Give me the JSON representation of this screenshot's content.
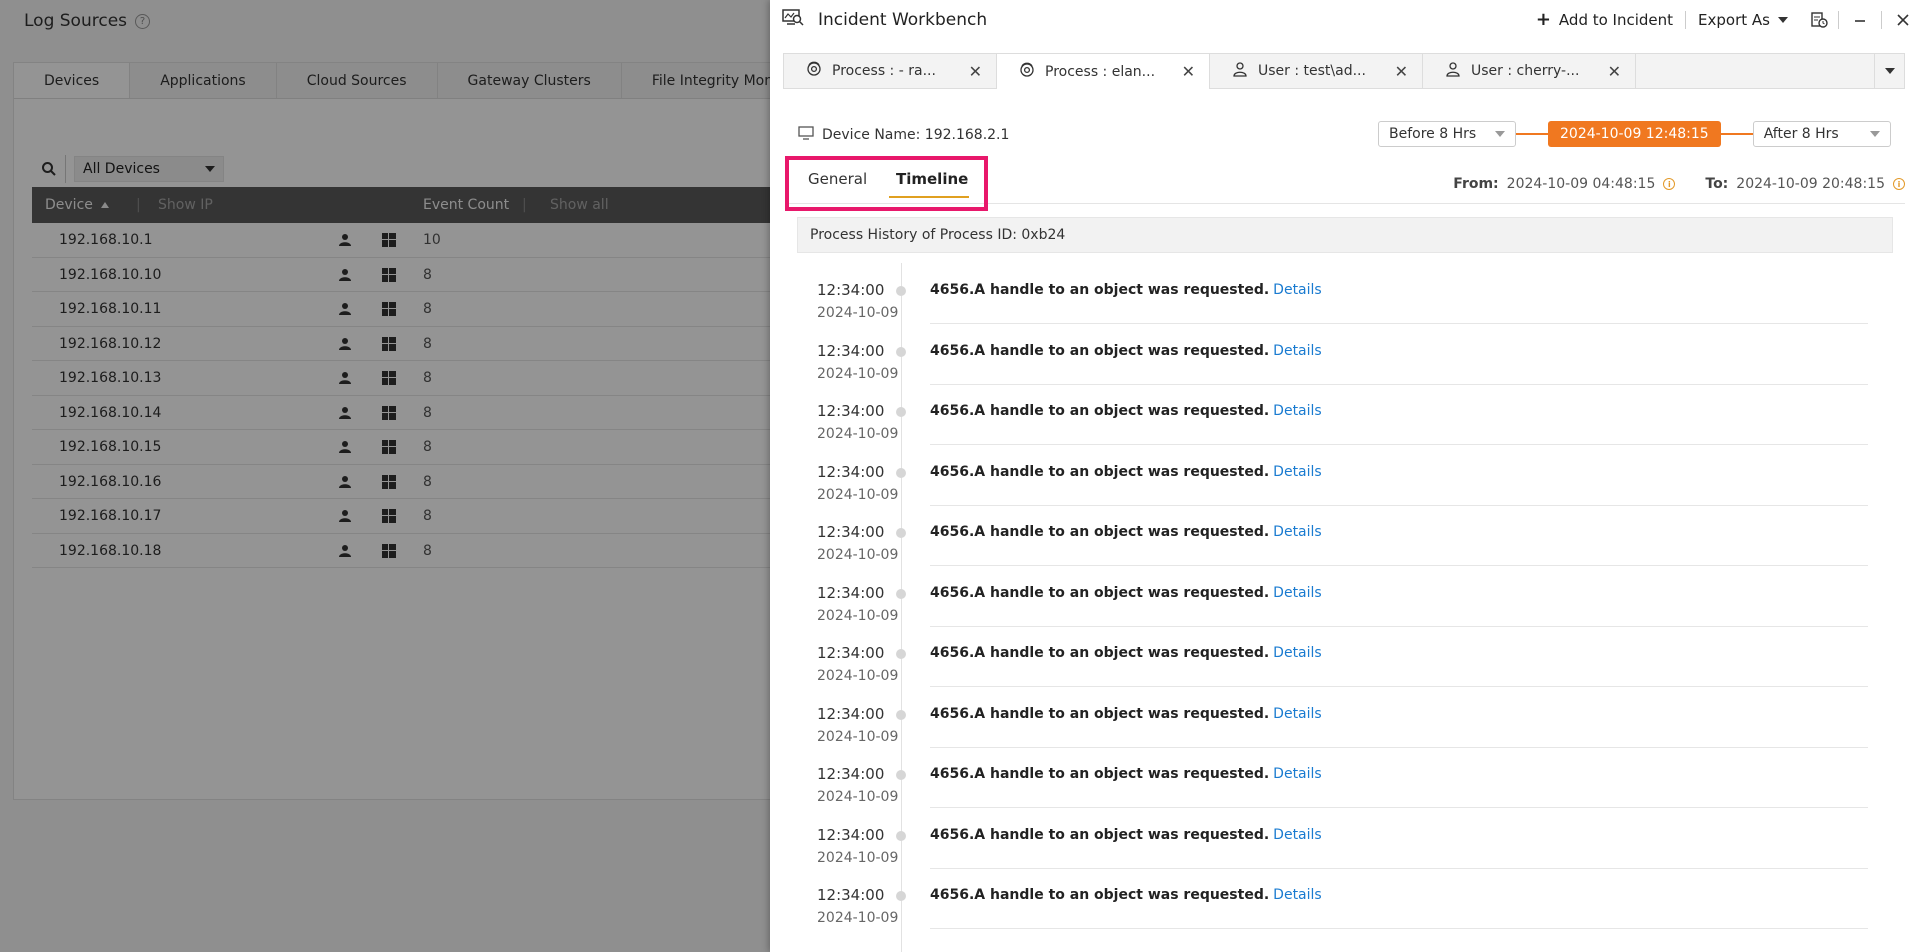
{
  "background": {
    "title": "Log Sources",
    "tabs": [
      "Devices",
      "Applications",
      "Cloud Sources",
      "Gateway Clusters",
      "File Integrity Monit"
    ],
    "filter_value": "All Devices",
    "columns": {
      "device": "Device",
      "show_ip": "Show IP",
      "event_count": "Event Count",
      "show_all": "Show all"
    },
    "rows": [
      {
        "ip": "192.168.10.1",
        "count": "10"
      },
      {
        "ip": "192.168.10.10",
        "count": "8"
      },
      {
        "ip": "192.168.10.11",
        "count": "8"
      },
      {
        "ip": "192.168.10.12",
        "count": "8"
      },
      {
        "ip": "192.168.10.13",
        "count": "8"
      },
      {
        "ip": "192.168.10.14",
        "count": "8"
      },
      {
        "ip": "192.168.10.15",
        "count": "8"
      },
      {
        "ip": "192.168.10.16",
        "count": "8"
      },
      {
        "ip": "192.168.10.17",
        "count": "8"
      },
      {
        "ip": "192.168.10.18",
        "count": "8"
      }
    ]
  },
  "workbench": {
    "title": "Incident Workbench",
    "add_to_incident": "Add to Incident",
    "export_as": "Export As",
    "tabs": [
      {
        "label": "Process : - ra...",
        "icon": "process-icon"
      },
      {
        "label": "Process : elan...",
        "icon": "process-icon",
        "active": true
      },
      {
        "label": "User : test\\ad...",
        "icon": "user-icon"
      },
      {
        "label": "User : cherry-...",
        "icon": "user-icon"
      }
    ],
    "device_name": "Device Name: 192.168.2.1",
    "before": "Before 8 Hrs",
    "center_time": "2024-10-09 12:48:15",
    "after": "After 8 Hrs",
    "subtabs": {
      "general": "General",
      "timeline": "Timeline"
    },
    "from_label": "From:",
    "from_value": "2024-10-09 04:48:15",
    "to_label": "To:",
    "to_value": "2024-10-09 20:48:15",
    "history_title": "Process History of Process ID: 0xb24",
    "events": [
      {
        "time": "12:34:00",
        "date": "2024-10-09",
        "message": "4656.A handle to an object was requested.",
        "link": "Details"
      },
      {
        "time": "12:34:00",
        "date": "2024-10-09",
        "message": "4656.A handle to an object was requested.",
        "link": "Details"
      },
      {
        "time": "12:34:00",
        "date": "2024-10-09",
        "message": "4656.A handle to an object was requested.",
        "link": "Details"
      },
      {
        "time": "12:34:00",
        "date": "2024-10-09",
        "message": "4656.A handle to an object was requested.",
        "link": "Details"
      },
      {
        "time": "12:34:00",
        "date": "2024-10-09",
        "message": "4656.A handle to an object was requested.",
        "link": "Details"
      },
      {
        "time": "12:34:00",
        "date": "2024-10-09",
        "message": "4656.A handle to an object was requested.",
        "link": "Details"
      },
      {
        "time": "12:34:00",
        "date": "2024-10-09",
        "message": "4656.A handle to an object was requested.",
        "link": "Details"
      },
      {
        "time": "12:34:00",
        "date": "2024-10-09",
        "message": "4656.A handle to an object was requested.",
        "link": "Details"
      },
      {
        "time": "12:34:00",
        "date": "2024-10-09",
        "message": "4656.A handle to an object was requested.",
        "link": "Details"
      },
      {
        "time": "12:34:00",
        "date": "2024-10-09",
        "message": "4656.A handle to an object was requested.",
        "link": "Details"
      },
      {
        "time": "12:34:00",
        "date": "2024-10-09",
        "message": "4656.A handle to an object was requested.",
        "link": "Details"
      }
    ]
  },
  "colors": {
    "accent_orange": "#f07820",
    "highlight_pink": "#e8186b",
    "link_blue": "#1a7bd0"
  }
}
